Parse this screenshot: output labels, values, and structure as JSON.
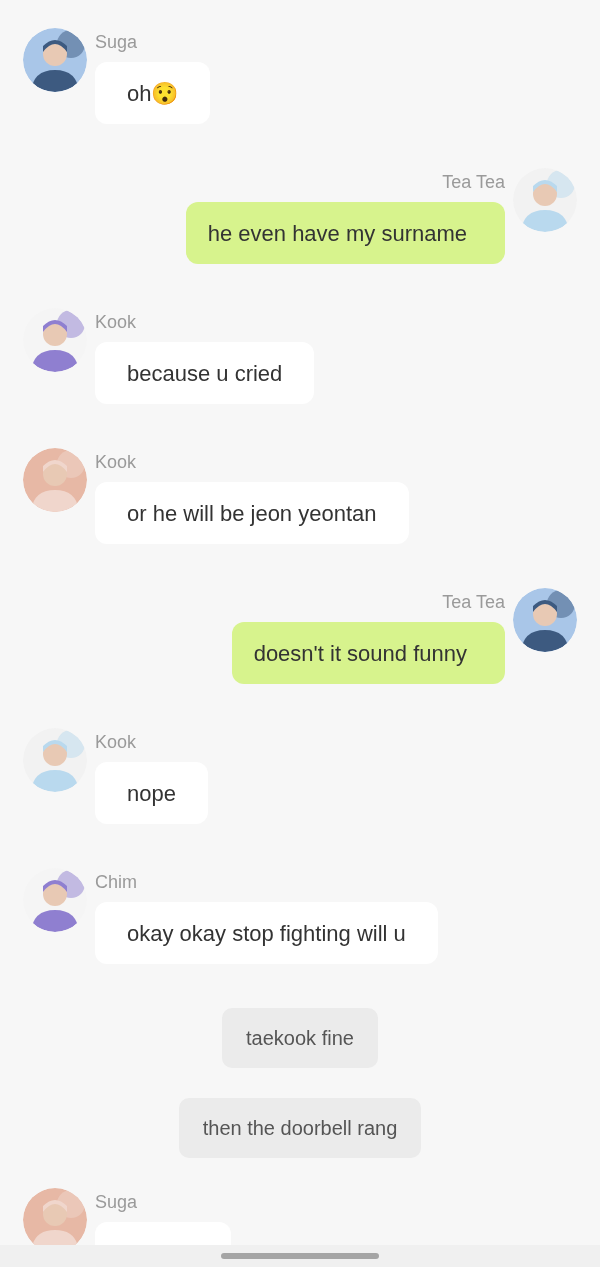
{
  "messages": [
    {
      "kind": "received",
      "sender": "Suga",
      "text": "oh😯"
    },
    {
      "kind": "sent",
      "sender": "Tea Tea",
      "text": "he even have my surname"
    },
    {
      "kind": "received",
      "sender": "Kook",
      "text": "because u cried"
    },
    {
      "kind": "received",
      "sender": "Kook",
      "text": "or he will be jeon yeontan"
    },
    {
      "kind": "sent",
      "sender": "Tea Tea",
      "text": "doesn't it sound funny"
    },
    {
      "kind": "received",
      "sender": "Kook",
      "text": "nope"
    },
    {
      "kind": "received",
      "sender": "Chim",
      "text": "okay okay stop fighting will u"
    },
    {
      "kind": "system",
      "text": "taekook fine"
    },
    {
      "kind": "system",
      "text": "then the doorbell rang"
    },
    {
      "kind": "received",
      "sender": "Suga"
    }
  ]
}
